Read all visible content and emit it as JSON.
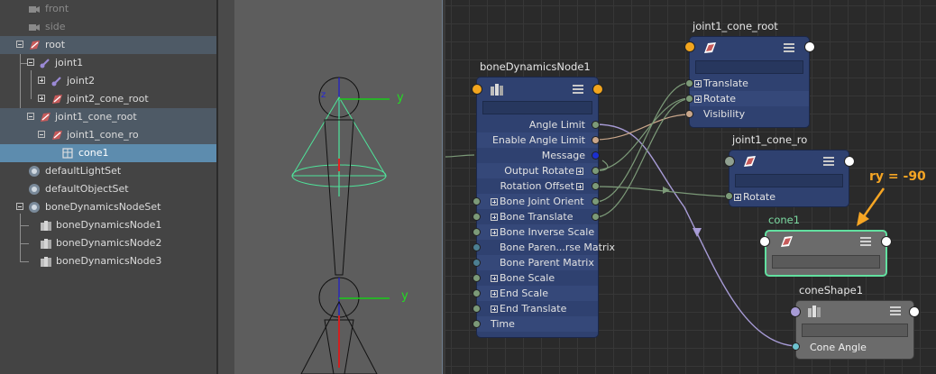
{
  "outliner": {
    "items": [
      {
        "label": "front"
      },
      {
        "label": "side"
      },
      {
        "label": "root"
      },
      {
        "label": "joint1"
      },
      {
        "label": "joint2"
      },
      {
        "label": "joint2_cone_root"
      },
      {
        "label": "joint1_cone_root"
      },
      {
        "label": "joint1_cone_ro"
      },
      {
        "label": "cone1"
      },
      {
        "label": "defaultLightSet"
      },
      {
        "label": "defaultObjectSet"
      },
      {
        "label": "boneDynamicsNodeSet"
      },
      {
        "label": "boneDynamicsNode1"
      },
      {
        "label": "boneDynamicsNode2"
      },
      {
        "label": "boneDynamicsNode3"
      }
    ]
  },
  "viewport": {
    "axis_label_top": "y",
    "axis_label_bottom": "y",
    "z_label": "z"
  },
  "graph": {
    "bone_node": {
      "title": "boneDynamicsNode1",
      "outputs": [
        "Angle Limit",
        "Enable Angle Limit",
        "Message",
        "Output Rotate",
        "Rotation Offset"
      ],
      "inputs": [
        "Bone Joint Orient",
        "Bone Translate",
        "Bone Inverse Scale",
        "Bone Paren...rse Matrix",
        "Bone Parent Matrix",
        "Bone Scale",
        "End Scale",
        "End Translate",
        "Time"
      ]
    },
    "cone_root_node": {
      "title": "joint1_cone_root",
      "attrs": [
        "Translate",
        "Rotate",
        "Visibility"
      ]
    },
    "cone_ro_node": {
      "title": "joint1_cone_ro",
      "attrs": [
        "Rotate"
      ]
    },
    "cone1_node": {
      "title": "cone1"
    },
    "coneshape_node": {
      "title": "coneShape1",
      "attrs": [
        "Cone Angle"
      ]
    },
    "annotation": "ry = -90"
  },
  "colors": {
    "accent_orange": "#f5a524",
    "selection_green": "#62e0a0",
    "node_blue": "#2f4170"
  }
}
